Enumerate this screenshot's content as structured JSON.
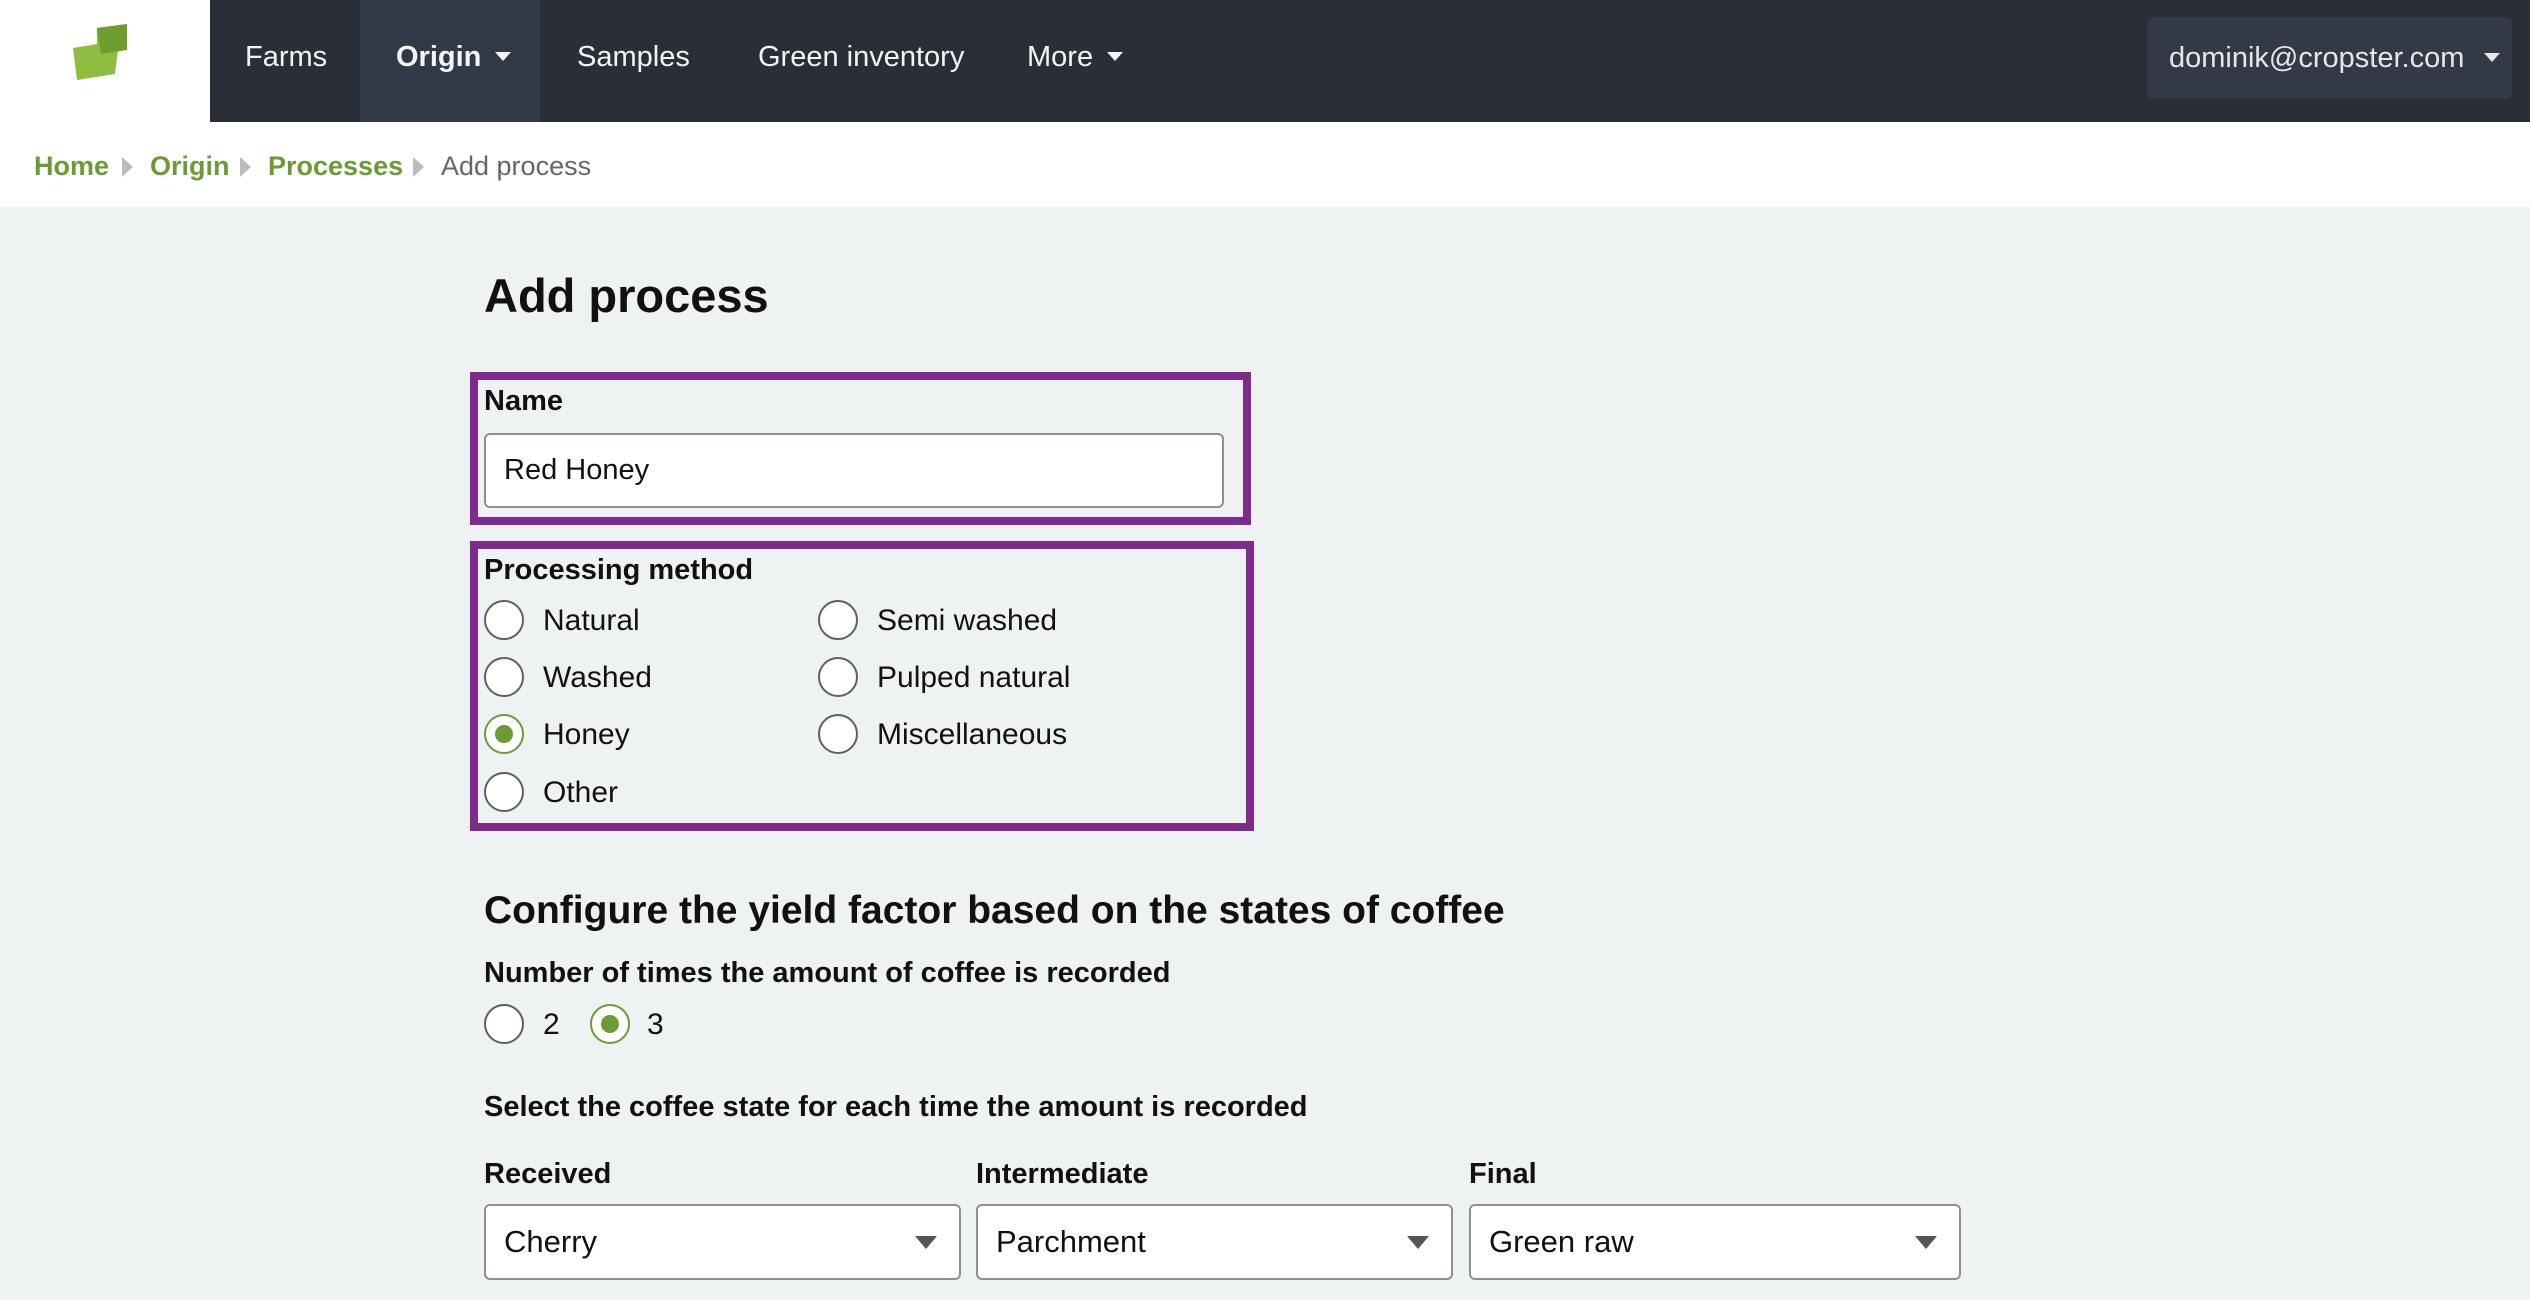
{
  "nav": {
    "items": [
      {
        "label": "Farms"
      },
      {
        "label": "Origin"
      },
      {
        "label": "Samples"
      },
      {
        "label": "Green inventory"
      },
      {
        "label": "More"
      }
    ],
    "user_email": "dominik@cropster.com"
  },
  "breadcrumb": [
    "Home",
    "Origin",
    "Processes",
    "Add process"
  ],
  "page_title": "Add process",
  "name_field": {
    "label": "Name",
    "value": "Red Honey"
  },
  "processing_method": {
    "label": "Processing method",
    "options": [
      "Natural",
      "Washed",
      "Honey",
      "Other",
      "Semi washed",
      "Pulped natural",
      "Miscellaneous"
    ],
    "selected": "Honey"
  },
  "yield_section": {
    "title": "Configure the yield factor based on the states of coffee",
    "count_label": "Number of times the amount of coffee is recorded",
    "count_options": [
      "2",
      "3"
    ],
    "count_selected": "3",
    "state_label": "Select the coffee state for each time the amount is recorded",
    "states": [
      {
        "label": "Received",
        "value": "Cherry"
      },
      {
        "label": "Intermediate",
        "value": "Parchment"
      },
      {
        "label": "Final",
        "value": "Green raw"
      }
    ]
  },
  "colors": {
    "nav_bg": "#2a2f37",
    "accent_green": "#6c9b35",
    "highlight_purple": "#7e2c8c",
    "page_bg": "#eff2f3"
  }
}
